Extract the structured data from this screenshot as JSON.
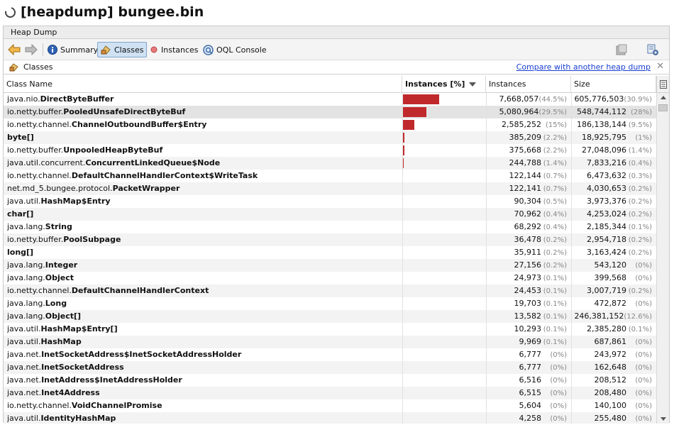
{
  "window": {
    "title": "[heapdump] bungee.bin"
  },
  "tab": {
    "label": "Heap Dump"
  },
  "toolbar": {
    "summary_label": "Summary",
    "classes_label": "Classes",
    "instances_label": "Instances",
    "oql_label": "OQL Console"
  },
  "classes_panel": {
    "title": "Classes",
    "compare_link": "Compare with another heap dump",
    "close_label": "✕"
  },
  "table": {
    "headers": {
      "class_name": "Class Name",
      "instances_pct": "Instances [%]",
      "instances": "Instances",
      "size": "Size"
    },
    "sorted_column": "Instances [%]",
    "rows": [
      {
        "pkg": "java.nio.",
        "cls": "DirectByteBuffer",
        "instances": "7,668,057",
        "inst_pct": "(44.5%)",
        "size": "605,776,503",
        "size_pct": "(30.9%)",
        "bar": 44.5
      },
      {
        "pkg": "io.netty.buffer.",
        "cls": "PooledUnsafeDirectByteBuf",
        "instances": "5,080,964",
        "inst_pct": "(29.5%)",
        "size": "548,744,112",
        "size_pct": "(28%)",
        "bar": 29.5
      },
      {
        "pkg": "io.netty.channel.",
        "cls": "ChannelOutboundBuffer$Entry",
        "instances": "2,585,252",
        "inst_pct": "(15%)",
        "size": "186,138,144",
        "size_pct": "(9.5%)",
        "bar": 15
      },
      {
        "pkg": "",
        "cls": "byte[]",
        "instances": "385,209",
        "inst_pct": "(2.2%)",
        "size": "18,925,795",
        "size_pct": "(1%)",
        "bar": 2.2
      },
      {
        "pkg": "io.netty.buffer.",
        "cls": "UnpooledHeapByteBuf",
        "instances": "375,668",
        "inst_pct": "(2.2%)",
        "size": "27,048,096",
        "size_pct": "(1.4%)",
        "bar": 2.2
      },
      {
        "pkg": "java.util.concurrent.",
        "cls": "ConcurrentLinkedQueue$Node",
        "instances": "244,788",
        "inst_pct": "(1.4%)",
        "size": "7,833,216",
        "size_pct": "(0.4%)",
        "bar": 1.4
      },
      {
        "pkg": "io.netty.channel.",
        "cls": "DefaultChannelHandlerContext$WriteTask",
        "instances": "122,144",
        "inst_pct": "(0.7%)",
        "size": "6,473,632",
        "size_pct": "(0.3%)",
        "bar": 0.7
      },
      {
        "pkg": "net.md_5.bungee.protocol.",
        "cls": "PacketWrapper",
        "instances": "122,141",
        "inst_pct": "(0.7%)",
        "size": "4,030,653",
        "size_pct": "(0.2%)",
        "bar": 0.7
      },
      {
        "pkg": "java.util.",
        "cls": "HashMap$Entry",
        "instances": "90,304",
        "inst_pct": "(0.5%)",
        "size": "3,973,376",
        "size_pct": "(0.2%)",
        "bar": 0.5
      },
      {
        "pkg": "",
        "cls": "char[]",
        "instances": "70,962",
        "inst_pct": "(0.4%)",
        "size": "4,253,024",
        "size_pct": "(0.2%)",
        "bar": 0
      },
      {
        "pkg": "java.lang.",
        "cls": "String",
        "instances": "68,292",
        "inst_pct": "(0.4%)",
        "size": "2,185,344",
        "size_pct": "(0.1%)",
        "bar": 0
      },
      {
        "pkg": "io.netty.buffer.",
        "cls": "PoolSubpage",
        "instances": "36,478",
        "inst_pct": "(0.2%)",
        "size": "2,954,718",
        "size_pct": "(0.2%)",
        "bar": 0
      },
      {
        "pkg": "",
        "cls": "long[]",
        "instances": "35,911",
        "inst_pct": "(0.2%)",
        "size": "3,163,424",
        "size_pct": "(0.2%)",
        "bar": 0
      },
      {
        "pkg": "java.lang.",
        "cls": "Integer",
        "instances": "27,156",
        "inst_pct": "(0.2%)",
        "size": "543,120",
        "size_pct": "(0%)",
        "bar": 0
      },
      {
        "pkg": "java.lang.",
        "cls": "Object",
        "instances": "24,973",
        "inst_pct": "(0.1%)",
        "size": "399,568",
        "size_pct": "(0%)",
        "bar": 0
      },
      {
        "pkg": "io.netty.channel.",
        "cls": "DefaultChannelHandlerContext",
        "instances": "24,453",
        "inst_pct": "(0.1%)",
        "size": "3,007,719",
        "size_pct": "(0.2%)",
        "bar": 0
      },
      {
        "pkg": "java.lang.",
        "cls": "Long",
        "instances": "19,703",
        "inst_pct": "(0.1%)",
        "size": "472,872",
        "size_pct": "(0%)",
        "bar": 0
      },
      {
        "pkg": "java.lang.",
        "cls": "Object[]",
        "instances": "13,582",
        "inst_pct": "(0.1%)",
        "size": "246,381,152",
        "size_pct": "(12.6%)",
        "bar": 0
      },
      {
        "pkg": "java.util.",
        "cls": "HashMap$Entry[]",
        "instances": "10,293",
        "inst_pct": "(0.1%)",
        "size": "2,385,280",
        "size_pct": "(0.1%)",
        "bar": 0
      },
      {
        "pkg": "java.util.",
        "cls": "HashMap",
        "instances": "9,969",
        "inst_pct": "(0.1%)",
        "size": "687,861",
        "size_pct": "(0%)",
        "bar": 0
      },
      {
        "pkg": "java.net.",
        "cls": "InetSocketAddress$InetSocketAddressHolder",
        "instances": "6,777",
        "inst_pct": "(0%)",
        "size": "243,972",
        "size_pct": "(0%)",
        "bar": 0
      },
      {
        "pkg": "java.net.",
        "cls": "InetSocketAddress",
        "instances": "6,777",
        "inst_pct": "(0%)",
        "size": "162,648",
        "size_pct": "(0%)",
        "bar": 0
      },
      {
        "pkg": "java.net.",
        "cls": "InetAddress$InetAddressHolder",
        "instances": "6,516",
        "inst_pct": "(0%)",
        "size": "208,512",
        "size_pct": "(0%)",
        "bar": 0
      },
      {
        "pkg": "java.net.",
        "cls": "Inet4Address",
        "instances": "6,515",
        "inst_pct": "(0%)",
        "size": "208,480",
        "size_pct": "(0%)",
        "bar": 0
      },
      {
        "pkg": "io.netty.channel.",
        "cls": "VoidChannelPromise",
        "instances": "5,604",
        "inst_pct": "(0%)",
        "size": "140,100",
        "size_pct": "(0%)",
        "bar": 0
      },
      {
        "pkg": "java.util.",
        "cls": "IdentityHashMap",
        "instances": "4,258",
        "inst_pct": "(0%)",
        "size": "255,480",
        "size_pct": "(0%)",
        "bar": 0
      }
    ]
  },
  "colors": {
    "bar": "#c0292c",
    "link": "#1a3fd0",
    "selected_tool": "#cfe1f3"
  },
  "icons": [
    "spinner-icon",
    "back-arrow-icon",
    "forward-arrow-icon",
    "info-icon",
    "classes-icon",
    "instances-icon",
    "oql-icon",
    "snapshot-icon",
    "settings-icon",
    "close-icon",
    "column-chooser-icon"
  ]
}
